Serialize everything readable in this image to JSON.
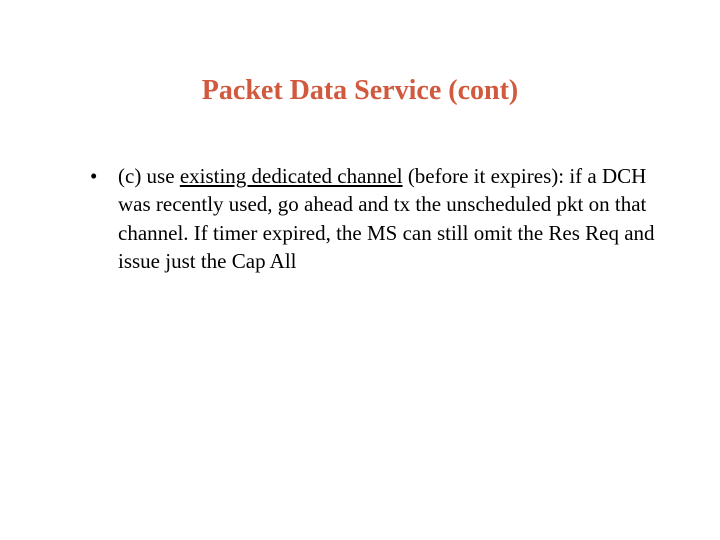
{
  "slide": {
    "title": "Packet Data Service (cont)",
    "bullet": {
      "prefix": "(c) use ",
      "underlined": "existing dedicated channel",
      "rest": " (before it expires): if a DCH was recently used, go ahead and tx the unscheduled pkt on that channel.  If timer expired, the MS can still omit the Res Req  and issue just the Cap All"
    }
  }
}
